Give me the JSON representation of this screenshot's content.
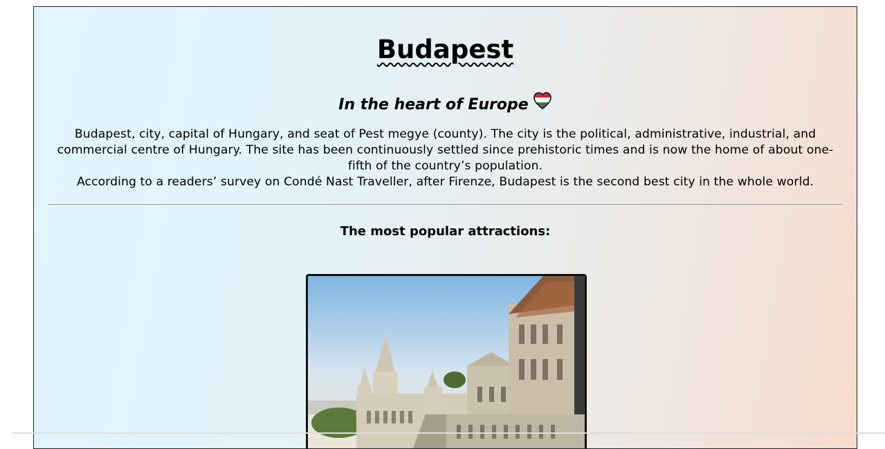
{
  "header": {
    "title": "Budapest",
    "subtitle": "In the heart of Europe",
    "subtitle_icon": "hungarian-flag-heart-icon"
  },
  "intro": {
    "paragraph1": "Budapest, city, capital of Hungary, and seat of Pest megye (county). The city is the political, administrative, industrial, and commercial centre of Hungary. The site has been continuously settled since prehistoric times and is now the home of about one-fifth of the country’s population.",
    "paragraph2": "According to a readers’ survey on Condé Nast Traveller, after Firenze, Budapest is the second best city in the whole world."
  },
  "attractions": {
    "heading": "The most popular attractions:",
    "image_subject": "fishermans-bastion-photo"
  },
  "colors": {
    "gradient_left": "#e0f5fd",
    "gradient_right": "#f7dccd",
    "flag_red": "#ce2939",
    "flag_white": "#ffffff",
    "flag_green": "#477050"
  }
}
